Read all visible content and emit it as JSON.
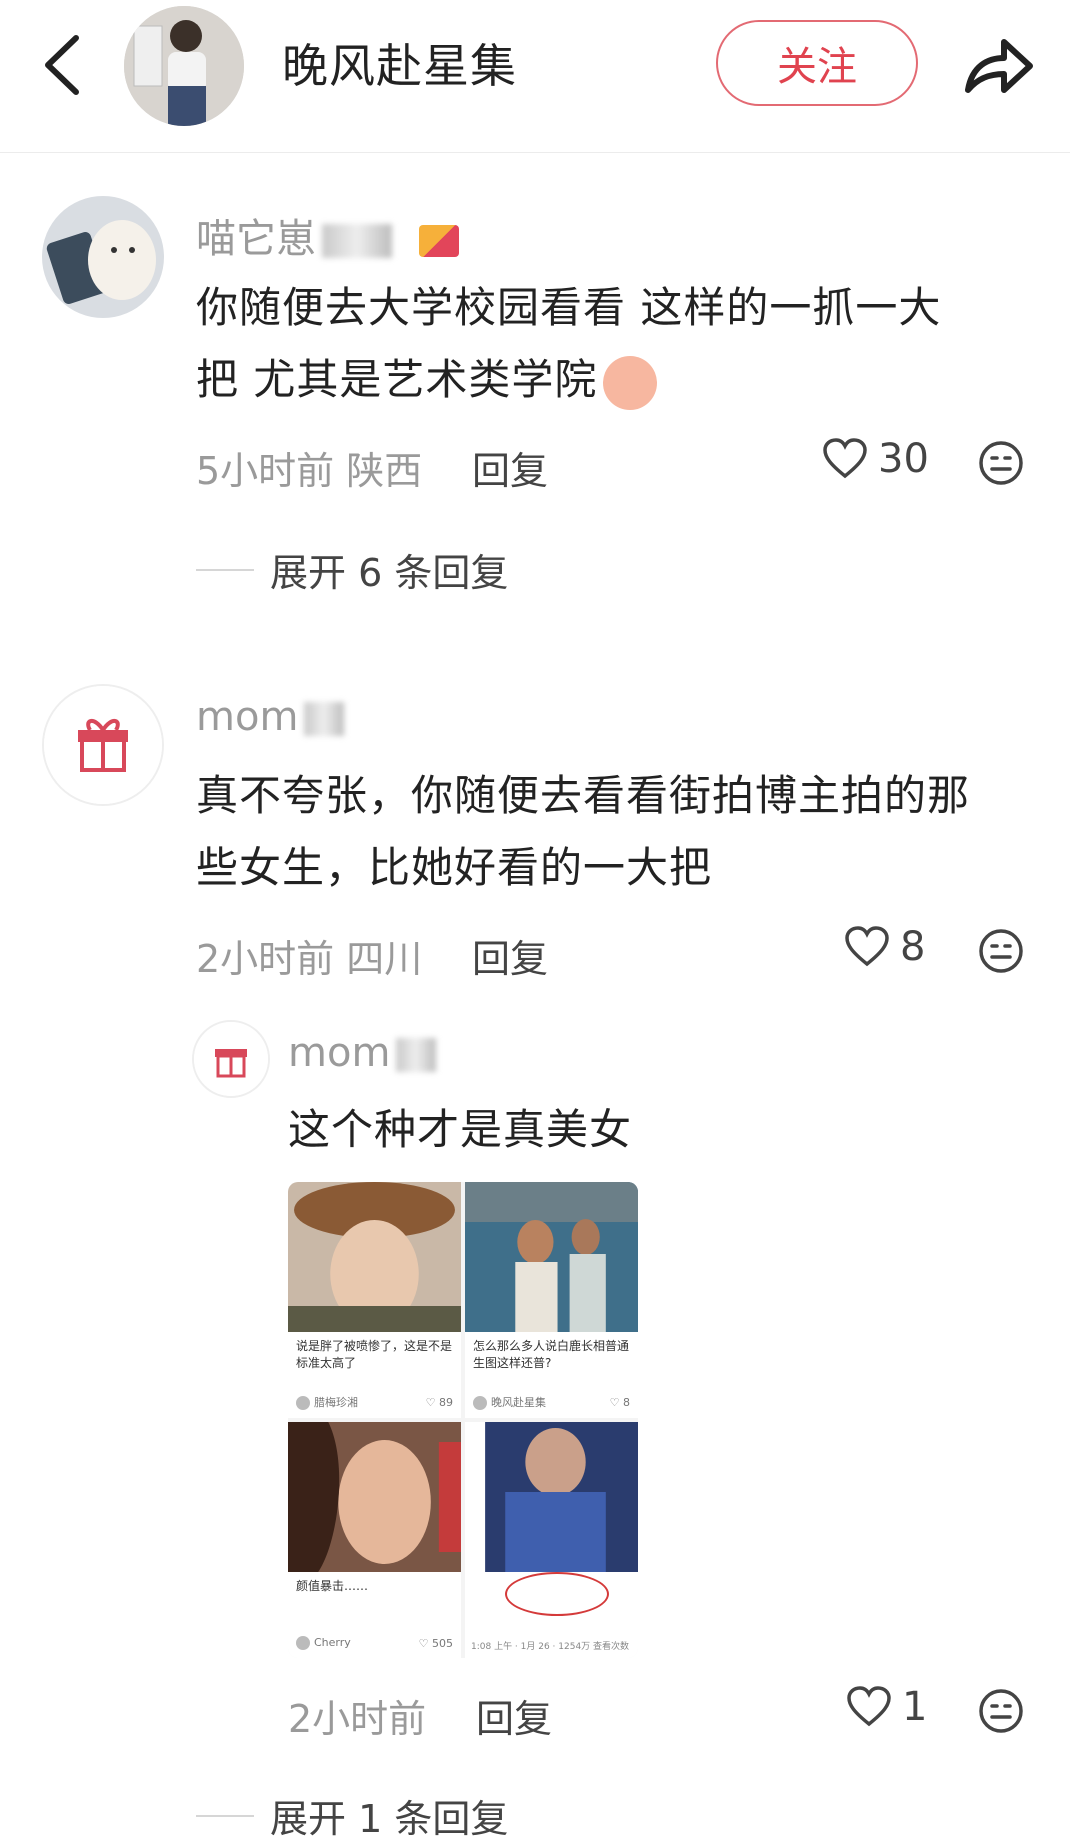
{
  "header": {
    "title": "晚风赴星集",
    "follow_label": "关注",
    "back_icon": "chevron-left-icon",
    "share_icon": "share-icon"
  },
  "comments": [
    {
      "username": "喵它崽",
      "text_line1": "你随便去大学校园看看 这样的一抓一大",
      "text_line2": "把 尤其是艺术类学院",
      "time": "5小时前",
      "location": "陕西",
      "reply_label": "回复",
      "likes": "30",
      "expand_label": "展开 6 条回复"
    },
    {
      "username": "mom",
      "text_line1": "真不夸张，你随便去看看街拍博主拍的那",
      "text_line2": "些女生，比她好看的一大把",
      "time": "2小时前",
      "location": "四川",
      "reply_label": "回复",
      "likes": "8"
    }
  ],
  "reply": {
    "username": "mom",
    "text": "这个种才是真美女",
    "time": "2小时前",
    "reply_label": "回复",
    "likes": "1",
    "expand_label": "展开 1 条回复",
    "grid": [
      {
        "caption": "说是胖了被喷惨了，这是不是标准太高了",
        "author": "腊梅珍湘",
        "likes": "89"
      },
      {
        "caption": "怎么那么多人说白鹿长相普通生图这样还普?",
        "author": "晚风赴星集",
        "likes": "8"
      },
      {
        "caption": "颜值暴击……",
        "author": "Cherry",
        "likes": "505"
      },
      {
        "stats": "1:08 上午 · 1月 26 · 1254万 查看次数"
      }
    ]
  },
  "colors": {
    "accent": "#e0434f",
    "muted": "#9a9a9a"
  }
}
